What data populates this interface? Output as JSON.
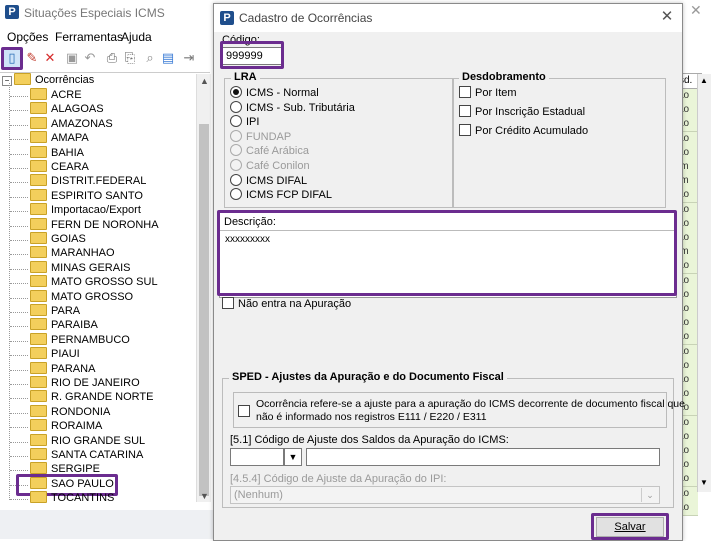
{
  "main_window": {
    "title": "Situações Especiais ICMS",
    "menu": [
      "Opções",
      "Ferramentas",
      "Ajuda"
    ]
  },
  "tree": {
    "root": "Ocorrências",
    "items": [
      "ACRE",
      "ALAGOAS",
      "AMAZONAS",
      "AMAPA",
      "BAHIA",
      "CEARA",
      "DISTRIT.FEDERAL",
      "ESPIRITO SANTO",
      "Importacao/Export",
      "FERN DE NORONHA",
      "GOIAS",
      "MARANHAO",
      "MINAS GERAIS",
      "MATO GROSSO SUL",
      "MATO GROSSO",
      "PARA",
      "PARAIBA",
      "PERNAMBUCO",
      "PIAUI",
      "PARANA",
      "RIO DE JANEIRO",
      "R. GRANDE NORTE",
      "RONDONIA",
      "RORAIMA",
      "RIO GRANDE SUL",
      "SANTA CATARINA",
      "SERGIPE",
      "SAO PAULO",
      "TOCANTINS"
    ],
    "selected": "SAO PAULO"
  },
  "grid": {
    "header": "sd.",
    "cells": [
      "ão",
      "ão",
      "ão",
      "ão",
      "ão",
      "im",
      "im",
      "ão",
      "ão",
      "ão",
      "ão",
      "im",
      "ão",
      "ão",
      "ão",
      "ão",
      "ão",
      "ão",
      "ão",
      "ão",
      "ão",
      "ão",
      "ão",
      "ão",
      "ão",
      "ão",
      "ão",
      "ão",
      "ão",
      "ão"
    ]
  },
  "dialog": {
    "title": "Cadastro de Ocorrências",
    "codigo_label": "Código:",
    "codigo_value": "999999",
    "lra": {
      "title": "LRA",
      "options": [
        {
          "label": "ICMS - Normal",
          "checked": true,
          "disabled": false
        },
        {
          "label": "ICMS - Sub. Tributária",
          "checked": false,
          "disabled": false
        },
        {
          "label": "IPI",
          "checked": false,
          "disabled": false
        },
        {
          "label": "FUNDAP",
          "checked": false,
          "disabled": true
        },
        {
          "label": "Café Arábica",
          "checked": false,
          "disabled": true
        },
        {
          "label": "Café Conilon",
          "checked": false,
          "disabled": true
        },
        {
          "label": "ICMS DIFAL",
          "checked": false,
          "disabled": false
        },
        {
          "label": "ICMS FCP DIFAL",
          "checked": false,
          "disabled": false
        }
      ]
    },
    "desdobramento": {
      "title": "Desdobramento",
      "options": [
        "Por Item",
        "Por Inscrição Estadual",
        "Por Crédito Acumulado"
      ]
    },
    "descricao_label": "Descrição:",
    "descricao_value": "xxxxxxxxx",
    "nao_entra_label": "Não entra na Apuração",
    "sped": {
      "title": "SPED - Ajustes da Apuração e do Documento Fiscal",
      "check_line1": "Ocorrência refere-se a ajuste para a apuração do ICMS decorrente de documento fiscal que",
      "check_line2": "não é informado nos registros E111 / E220 / E311",
      "ajuste_label": "[5.1] Código de Ajuste dos Saldos da Apuração do ICMS:",
      "ipi_label": "[4.5.4] Código de Ajuste da Apuração do IPI:",
      "ipi_value": "(Nenhum)"
    },
    "save_label": "Salvar"
  }
}
